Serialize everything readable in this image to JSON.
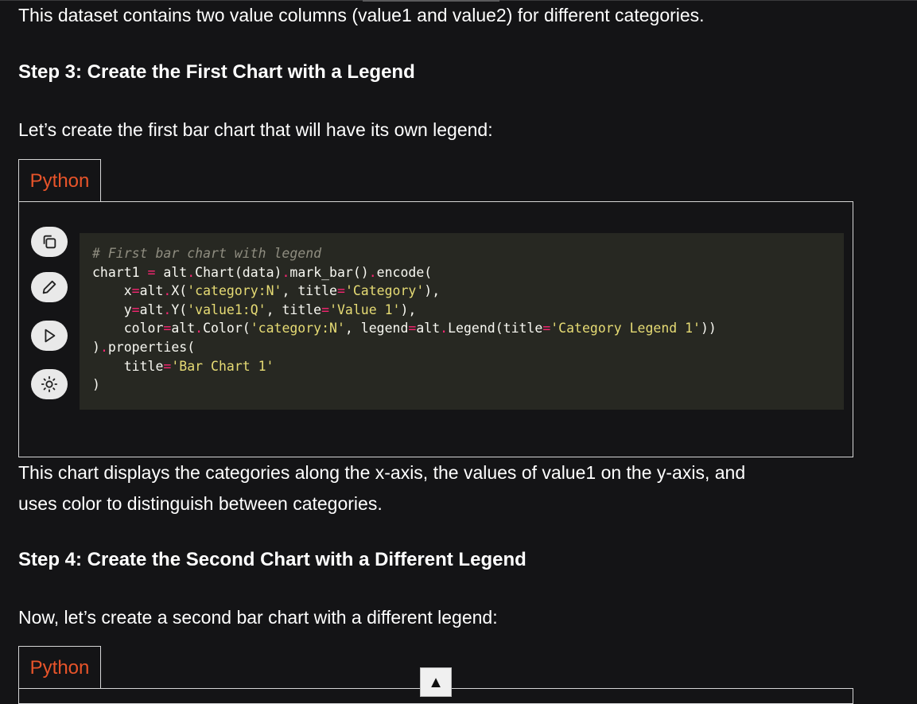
{
  "intro_text": "This dataset contains two value columns (value1 and value2) for different categories.",
  "step3_heading": "Step 3: Create the First Chart with a Legend",
  "step3_text": "Let’s create the first bar chart that will have its own legend:",
  "code_tab_label": "Python",
  "toolbar": {
    "icons": [
      "copy-icon",
      "edit-icon",
      "run-icon",
      "theme-icon"
    ]
  },
  "code_lines": {
    "l1": "# First bar chart with legend",
    "l2a": "chart1 ",
    "l2b": "=",
    "l2c": " alt",
    "l2d": ".",
    "l2e": "Chart(data)",
    "l2f": ".",
    "l2g": "mark_bar()",
    "l2h": ".",
    "l2i": "encode(",
    "l3a": "    x",
    "l3b": "=",
    "l3c": "alt",
    "l3d": ".",
    "l3e": "X(",
    "l3f": "'category:N'",
    "l3g": ", title",
    "l3h": "=",
    "l3i": "'Category'",
    "l3j": "),",
    "l4a": "    y",
    "l4b": "=",
    "l4c": "alt",
    "l4d": ".",
    "l4e": "Y(",
    "l4f": "'value1:Q'",
    "l4g": ", title",
    "l4h": "=",
    "l4i": "'Value 1'",
    "l4j": "),",
    "l5a": "    color",
    "l5b": "=",
    "l5c": "alt",
    "l5d": ".",
    "l5e": "Color(",
    "l5f": "'category:N'",
    "l5g": ", legend",
    "l5h": "=",
    "l5i": "alt",
    "l5j": ".",
    "l5k": "Legend(title",
    "l5l": "=",
    "l5m": "'Category Legend 1'",
    "l5n": "))",
    "l6a": ")",
    "l6b": ".",
    "l6c": "properties(",
    "l7a": "    title",
    "l7b": "=",
    "l7c": "'Bar Chart 1'",
    "l8": ")"
  },
  "after_chart_text_1": "This chart displays the categories along the x-axis, the values of value1 on the y-axis, and",
  "after_chart_text_2": "uses color to distinguish between categories.",
  "step4_heading": "Step 4: Create the Second Chart with a Different Legend",
  "step4_text": "Now, let’s create a second bar chart with a different legend:",
  "code_tab_label_2": "Python",
  "scroll_top_label": "▲"
}
